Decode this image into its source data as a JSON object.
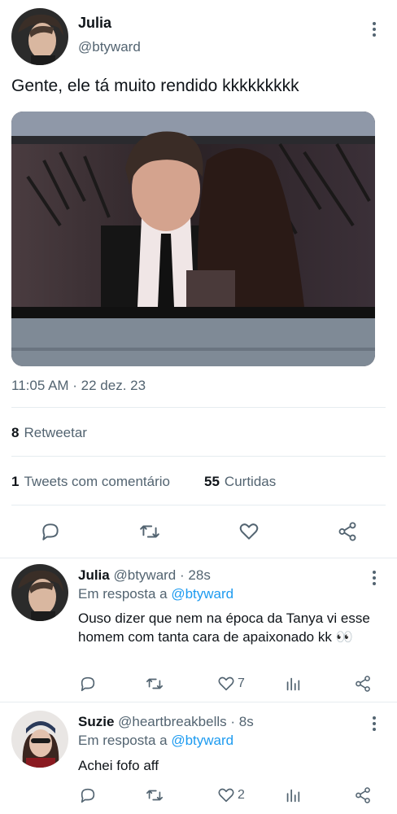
{
  "main_tweet": {
    "author_name": "Julia",
    "author_handle": "@btyward",
    "text": "Gente, ele tá muito rendido kkkkkkkkk",
    "timestamp": "11:05 AM · 22 dez. 23",
    "retweets_count": "8",
    "retweets_label": "Retweetar",
    "quotes_count": "1",
    "quotes_label": "Tweets com comentário",
    "likes_count": "55",
    "likes_label": "Curtidas"
  },
  "replies": [
    {
      "author_name": "Julia",
      "author_handle": "@btyward",
      "time": "28s",
      "reply_prefix": "Em resposta a",
      "reply_to": "@btyward",
      "text": "Ouso dizer que nem na época da Tanya vi esse homem com tanta cara de apaixonado kk 👀",
      "like_count": "7"
    },
    {
      "author_name": "Suzie",
      "author_handle": "@heartbreakbells",
      "time": "8s",
      "reply_prefix": "Em resposta a",
      "reply_to": "@btyward",
      "text": "Achei fofo aff",
      "like_count": "2"
    }
  ],
  "separator": "·",
  "icons": {
    "more": "more-vertical-icon",
    "reply": "reply-icon",
    "retweet": "retweet-icon",
    "like": "heart-icon",
    "analytics": "analytics-icon",
    "share": "share-icon"
  },
  "colors": {
    "text": "#0f1419",
    "secondary": "#536471",
    "link": "#1d9bf0",
    "divider": "#e6ecf0"
  }
}
